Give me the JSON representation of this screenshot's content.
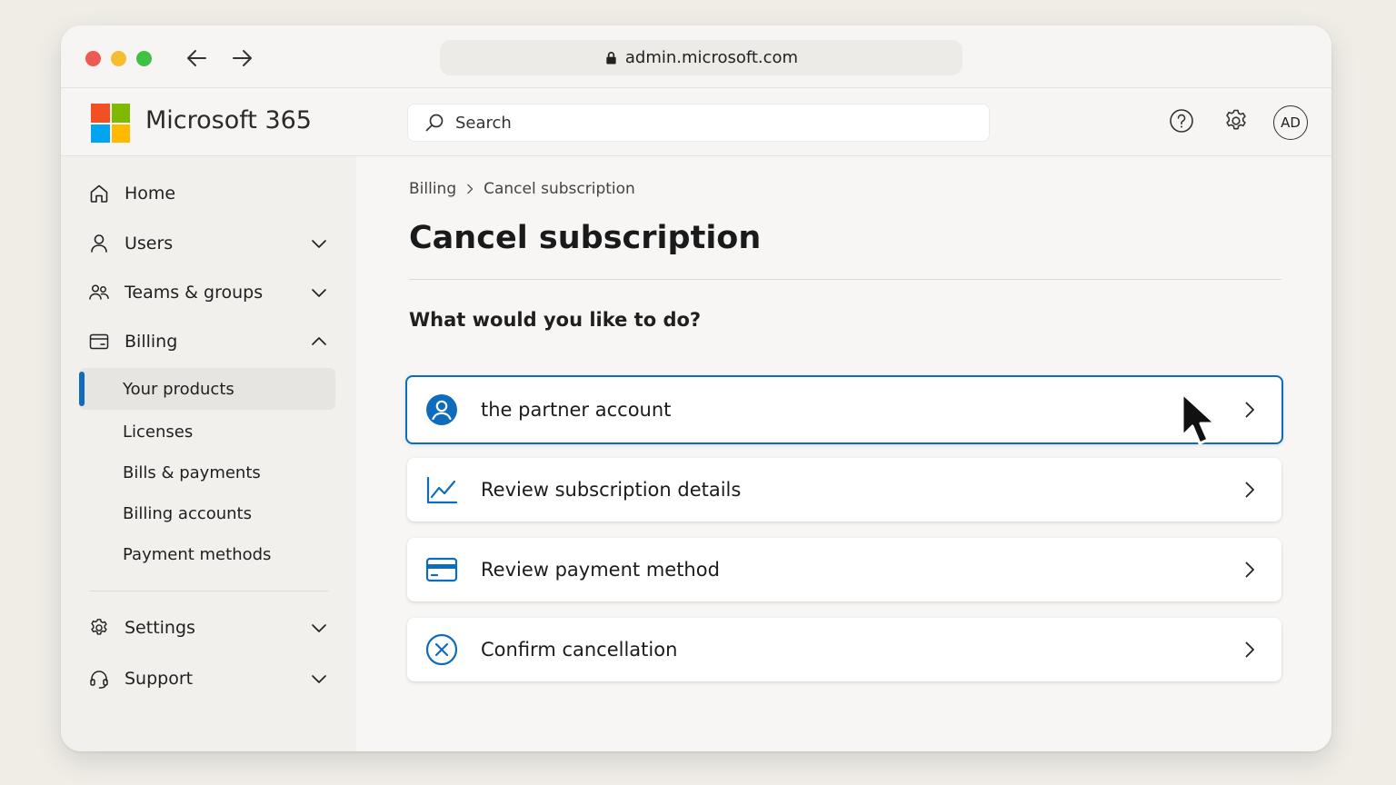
{
  "browser": {
    "url": "admin.microsoft.com"
  },
  "header": {
    "brand": "Microsoft 365",
    "search_placeholder": "Search",
    "avatar_initials": "AD"
  },
  "sidebar": {
    "items": [
      {
        "label": "Home"
      },
      {
        "label": "Users"
      },
      {
        "label": "Teams & groups"
      },
      {
        "label": "Billing"
      },
      {
        "label": "Settings"
      },
      {
        "label": "Support"
      }
    ],
    "billing_subitems": [
      {
        "label": "Your products",
        "selected": true
      },
      {
        "label": "Licenses"
      },
      {
        "label": "Bills & payments"
      },
      {
        "label": "Billing accounts"
      },
      {
        "label": "Payment methods"
      }
    ]
  },
  "main": {
    "breadcrumb": [
      "Billing",
      "Cancel subscription"
    ],
    "title": "Cancel subscription",
    "question": "What would you like to do?",
    "options": [
      {
        "label": "the partner account",
        "icon": "person-circle-icon"
      },
      {
        "label": "Review subscription details",
        "icon": "line-chart-icon"
      },
      {
        "label": "Review payment method",
        "icon": "credit-card-icon"
      },
      {
        "label": "Confirm cancellation",
        "icon": "dismiss-circle-icon"
      }
    ]
  },
  "colors": {
    "accent": "#0f6cbd",
    "ms_red": "#f25022",
    "ms_green": "#7fba00",
    "ms_blue": "#00a4ef",
    "ms_yellow": "#ffb900"
  }
}
